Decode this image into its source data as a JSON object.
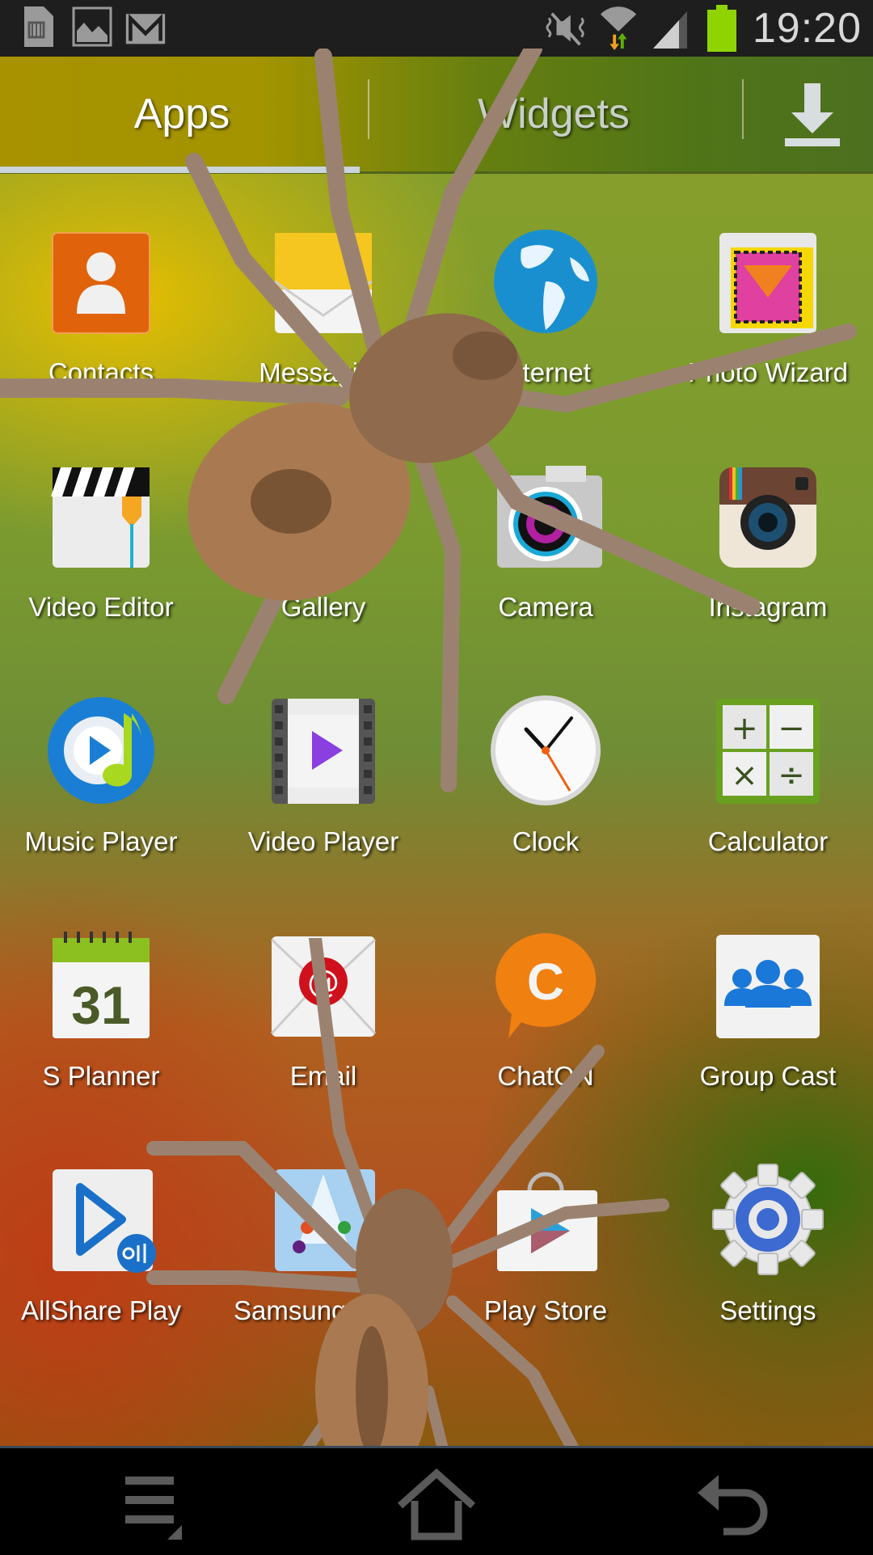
{
  "status_bar": {
    "left_icons": [
      "sd-card-icon",
      "gallery-notification-icon",
      "gmail-icon"
    ],
    "right_icons": [
      "mute-icon",
      "wifi-icon",
      "signal-icon",
      "battery-icon"
    ],
    "time": "19:20",
    "battery_color": "#8fd400"
  },
  "tabs": {
    "apps": "Apps",
    "widgets": "Widgets",
    "active": "Apps",
    "download_icon": "download-icon"
  },
  "apps": [
    {
      "label": "Contacts",
      "icon": "contacts-icon"
    },
    {
      "label": "Messaging",
      "icon": "messaging-icon"
    },
    {
      "label": "Internet",
      "icon": "internet-icon"
    },
    {
      "label": "Photo Wizard",
      "icon": "photo-wizard-icon"
    },
    {
      "label": "Video Editor",
      "icon": "video-editor-icon"
    },
    {
      "label": "Gallery",
      "icon": "gallery-icon"
    },
    {
      "label": "Camera",
      "icon": "camera-icon"
    },
    {
      "label": "Instagram",
      "icon": "instagram-icon"
    },
    {
      "label": "Music Player",
      "icon": "music-player-icon"
    },
    {
      "label": "Video Player",
      "icon": "video-player-icon"
    },
    {
      "label": "Clock",
      "icon": "clock-icon"
    },
    {
      "label": "Calculator",
      "icon": "calculator-icon"
    },
    {
      "label": "S Planner",
      "icon": "calendar-icon",
      "badge": "31"
    },
    {
      "label": "Email",
      "icon": "email-icon"
    },
    {
      "label": "ChatON",
      "icon": "chaton-icon"
    },
    {
      "label": "Group Cast",
      "icon": "group-cast-icon"
    },
    {
      "label": "AllShare Play",
      "icon": "allshare-play-icon"
    },
    {
      "label": "Samsung Apps",
      "icon": "samsung-apps-icon"
    },
    {
      "label": "Play Store",
      "icon": "play-store-icon"
    },
    {
      "label": "Settings",
      "icon": "settings-icon"
    }
  ],
  "calculator_symbols": [
    "+",
    "−",
    "×",
    "÷"
  ],
  "nav_bar": {
    "menu": "menu-icon",
    "home": "home-icon",
    "back": "back-icon"
  }
}
